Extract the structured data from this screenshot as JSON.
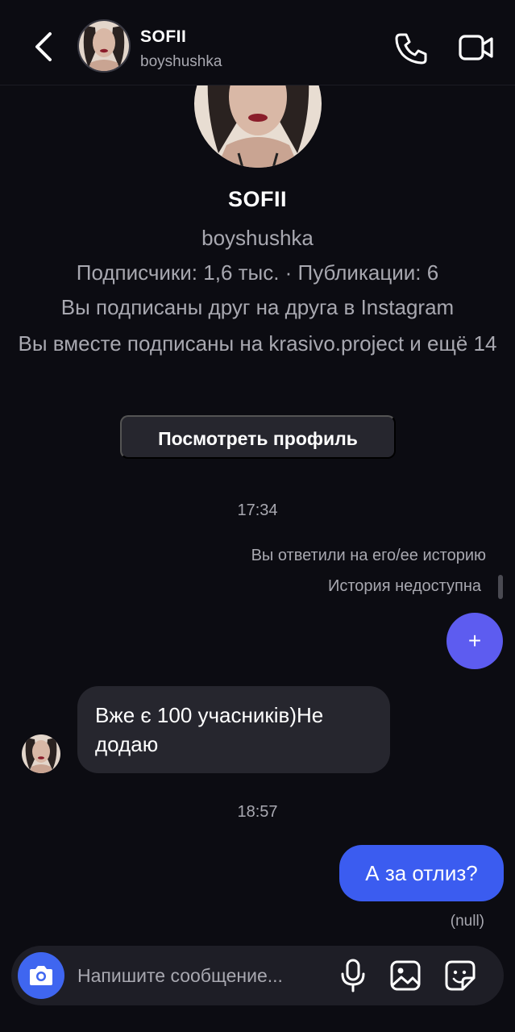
{
  "header": {
    "name": "SOFII",
    "username": "boyshushka"
  },
  "profile": {
    "name": "SOFII",
    "username": "boyshushka",
    "stats": "Подписчики: 1,6 тыс. · Публикации: 6",
    "mutual": "Вы подписаны друг на друга в Instagram",
    "common_following": "Вы вместе подписаны на krasivo.project и ещё 14",
    "view_profile_label": "Посмотреть профиль"
  },
  "messages": {
    "time_1": "17:34",
    "replied_story": "Вы ответили на его/ее историю",
    "story_unavailable": "История недоступна",
    "fab_label": "+",
    "incoming_text": "Вже є 100 учасників)Не додаю",
    "time_2": "18:57",
    "outgoing_text": "А за отлиз?",
    "outgoing_status": "(null)"
  },
  "composer": {
    "placeholder": "Напишите сообщение..."
  },
  "colors": {
    "background": "#0c0c12",
    "bubble_incoming": "#26262e",
    "bubble_outgoing": "#3b5cf0",
    "fab": "#5d5cf0",
    "camera": "#3f66f0",
    "secondary_text": "#a8a8b0"
  },
  "icons": [
    "back-arrow-icon",
    "phone-icon",
    "video-camera-icon",
    "plus-icon",
    "camera-icon",
    "microphone-icon",
    "gallery-icon",
    "sticker-icon"
  ]
}
